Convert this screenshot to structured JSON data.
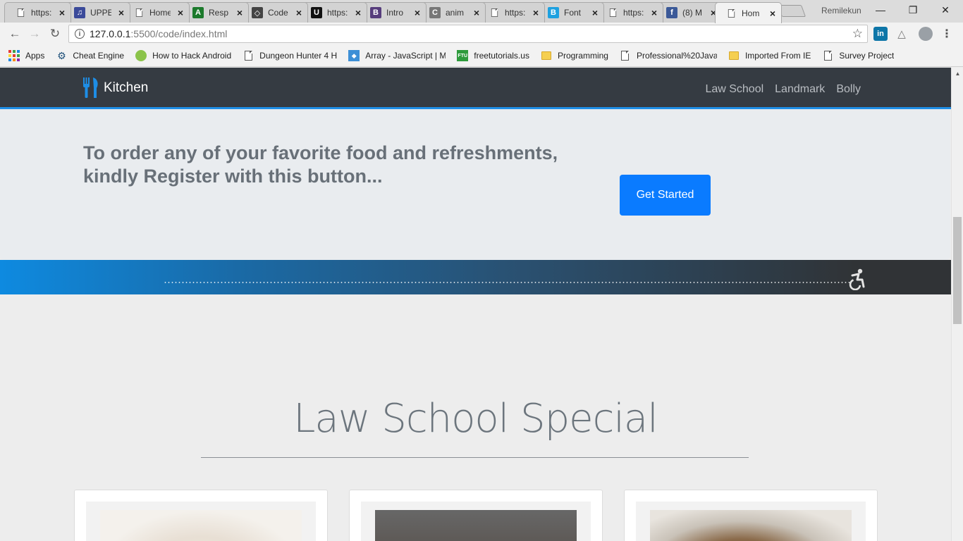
{
  "browser": {
    "tabs": [
      {
        "label": "https:",
        "icon": "page-icon",
        "color": "#666666"
      },
      {
        "label": "UPPE",
        "icon": "itunes-icon",
        "color": "#3b4a9a"
      },
      {
        "label": "Home",
        "icon": "page-icon",
        "color": "#666666"
      },
      {
        "label": "Resp",
        "icon": "app-icon",
        "color": "#1c7a2c"
      },
      {
        "label": "Code",
        "icon": "codepen-icon",
        "color": "#444444"
      },
      {
        "label": "https:",
        "icon": "udemy-icon",
        "color": "#111111"
      },
      {
        "label": "Intro",
        "icon": "bootstrap-icon",
        "color": "#563d7c"
      },
      {
        "label": "anim",
        "icon": "letter-c-icon",
        "color": "#777777"
      },
      {
        "label": "https:",
        "icon": "page-icon",
        "color": "#666666"
      },
      {
        "label": "Font",
        "icon": "blogger-icon",
        "color": "#1ea1e0"
      },
      {
        "label": "https:",
        "icon": "page-icon",
        "color": "#666666"
      },
      {
        "label": "(8) M",
        "icon": "facebook-icon",
        "color": "#3b5998"
      },
      {
        "label": "Hom",
        "icon": "page-icon",
        "color": "#666666"
      }
    ],
    "profile_name": "Remilekun",
    "window_controls": {
      "minimize": "—",
      "restore": "❐",
      "close": "✕"
    },
    "url": {
      "host": "127.0.0.1",
      "path": ":5500/code/index.html"
    },
    "bookmarks": [
      {
        "label": "Apps",
        "icon": "apps-icon"
      },
      {
        "label": "Cheat Engine",
        "icon": "cheat-engine-icon"
      },
      {
        "label": "How to Hack Android",
        "icon": "android-icon"
      },
      {
        "label": "Dungeon Hunter 4 H",
        "icon": "page-icon"
      },
      {
        "label": "Array - JavaScript | M",
        "icon": "mdn-icon"
      },
      {
        "label": "freetutorials.us",
        "icon": "ftu-icon"
      },
      {
        "label": "Programming",
        "icon": "folder-icon"
      },
      {
        "label": "Professional%20JavaS",
        "icon": "page-icon"
      },
      {
        "label": "Imported From IE",
        "icon": "folder-icon"
      },
      {
        "label": "Survey Project",
        "icon": "page-icon"
      }
    ]
  },
  "site": {
    "brand": "Kitchen",
    "nav": [
      "Law School",
      "Landmark",
      "Bolly"
    ],
    "jumbotron": {
      "text": "To order any of your favorite food and refreshments, kindly Register with this button...",
      "button": "Get Started"
    },
    "section_title": "Law School Special",
    "colors": {
      "nav_bg": "#353b42",
      "accent": "#1e8ee6",
      "button": "#0a7bff",
      "jumbo_bg": "#e9ecef"
    }
  }
}
